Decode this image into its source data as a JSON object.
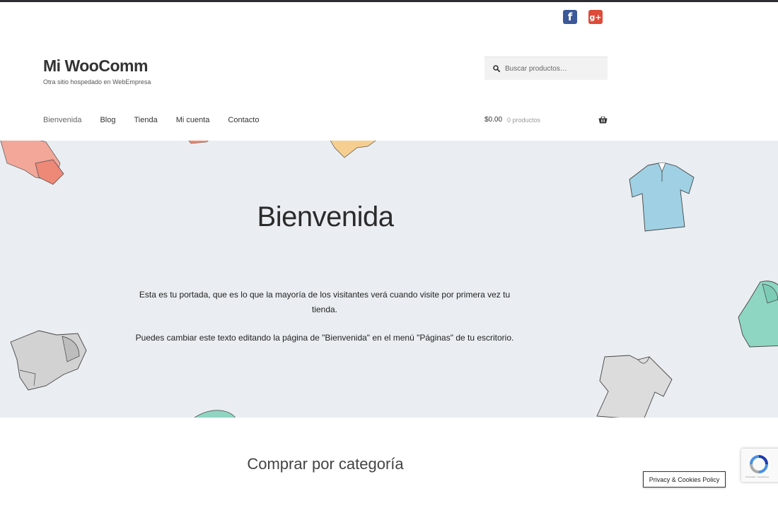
{
  "site": {
    "title": "Mi WooComm",
    "description": "Otra sitio hospedado en WebEmpresa"
  },
  "social": {
    "facebook_icon": "facebook-icon",
    "googleplus_icon": "google-plus-icon",
    "facebook_glyph": "f",
    "googleplus_glyph": "g+"
  },
  "search": {
    "placeholder": "Buscar productos…"
  },
  "nav": {
    "items": [
      {
        "label": "Bienvenida"
      },
      {
        "label": "Blog"
      },
      {
        "label": "Tienda"
      },
      {
        "label": "Mi cuenta"
      },
      {
        "label": "Contacto"
      }
    ]
  },
  "cart": {
    "price": "$0.00",
    "count": "0 productos"
  },
  "hero": {
    "title": "Bienvenida",
    "paragraph1": "Esta es tu portada, que es lo que la mayoría de los visitantes verá cuando visite por primera vez tu tienda.",
    "paragraph2": "Puedes cambiar este texto editando la página de \"Bienvenida\" en el menú \"Páginas\" de tu escritorio."
  },
  "section": {
    "title": "Comprar por categoría"
  },
  "recaptcha": {
    "label": "Privacidad - Condiciones"
  },
  "privacy": {
    "label": "Privacy & Cookies Policy"
  },
  "colors": {
    "topbar": "#2c2d33",
    "hero_bg": "#eaeef2",
    "facebook": "#3b5998",
    "googleplus": "#dd4b39"
  }
}
